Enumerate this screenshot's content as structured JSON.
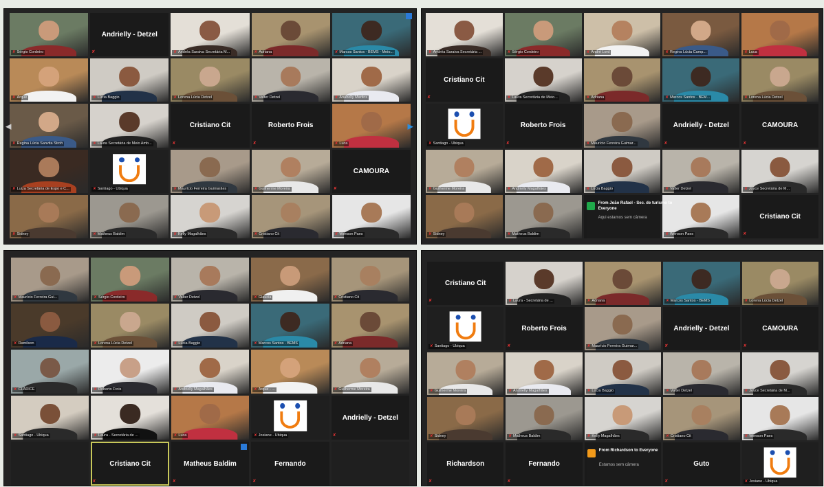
{
  "colors": {
    "tile_bg": "#1f1f1f",
    "active_border": "#c8c85a",
    "mic_muted": "#e03333",
    "logo_orange": "#f07c10",
    "logo_blue": "#1c4fb0",
    "chat_icon_green": "#1fa84a",
    "chat_icon_orange": "#f39a1a"
  },
  "icons": {
    "muted": "mic-muted-icon",
    "nav_left": "chevron-left-icon",
    "nav_right": "chevron-right-icon"
  },
  "panels": [
    {
      "cols": 5,
      "rows": 5,
      "tiles": [
        {
          "n": "Sérgio Cordeiro",
          "v": 1,
          "a": 1,
          "c": [
            "#6b7b63",
            "#c99a7a",
            "#8a2a2a"
          ]
        },
        {
          "b": "Andrielly - Detzel"
        },
        {
          "n": "Andréa Saraiva Secretária M...",
          "v": 1,
          "c": [
            "#e4dfd7",
            "#8a5a44",
            "#3a2c26"
          ]
        },
        {
          "n": "Adriana",
          "v": 1,
          "c": [
            "#a8936f",
            "#6b4a38",
            "#7b2a2a"
          ]
        },
        {
          "n": "Marcos Santos - BEMS - Meio...",
          "v": 1,
          "c": [
            "#3a6a78",
            "#3d2a22",
            "#2a8aa8"
          ]
        },
        {
          "n": "Arque",
          "v": 1,
          "c": [
            "#b98a58",
            "#d4a27a",
            "#f2f2f2"
          ]
        },
        {
          "n": "Lúcia Baggio",
          "v": 1,
          "c": [
            "#cfcbc4",
            "#8b5a40",
            "#223248"
          ]
        },
        {
          "n": "Lorena Lúcia Detzel",
          "v": 1,
          "c": [
            "#9a8a64",
            "#c9a78e",
            "#6b5038"
          ]
        },
        {
          "n": "Valter Detzel",
          "v": 1,
          "c": [
            "#b9b4aa",
            "#a87a5c",
            "#2a2a30"
          ]
        },
        {
          "n": "Anahelly Martins",
          "v": 1,
          "c": [
            "#d9d3c9",
            "#a06a48",
            "#e9eaf0"
          ]
        },
        {
          "n": "Regina Lúcia Sanvita Stroh",
          "v": 1,
          "c": [
            "#6a5a48",
            "#d2a888",
            "#3a5a88"
          ]
        },
        {
          "n": "Laura Secretária de Meio Amb...",
          "v": 1,
          "c": [
            "#d6d2cc",
            "#5a3a2a",
            "#222222"
          ]
        },
        {
          "b": "Cristiano Cit"
        },
        {
          "b": "Roberto Frois"
        },
        {
          "n": "Luca",
          "v": 1,
          "c": [
            "#b57848",
            "#a06a48",
            "#c03040"
          ]
        },
        {
          "n": "Luiza Secretária de Espo e C...",
          "v": 1,
          "c": [
            "#3a2a22",
            "#aa7a5a",
            "#a84020"
          ]
        },
        {
          "n": "Santiago - Ubiqua",
          "logo": 1
        },
        {
          "n": "Maurício Ferreira Guimarães",
          "v": 1,
          "c": [
            "#a89a8a",
            "#8a6a50",
            "#303840"
          ]
        },
        {
          "n": "Guilherme Moreira",
          "v": 1,
          "c": [
            "#b7ab98",
            "#b08060",
            "#e8e8e8"
          ]
        },
        {
          "b": "CAMOURA"
        },
        {
          "n": "Sidney",
          "v": 1,
          "c": [
            "#8a6a48",
            "#a87a58",
            "#4a3a30"
          ]
        },
        {
          "n": "Matheus Baldim",
          "v": 1,
          "c": [
            "#9c9890",
            "#8a6a50",
            "#2a2a2a"
          ]
        },
        {
          "n": "Kelly Magalhães",
          "v": 1,
          "c": [
            "#d6d4d0",
            "#c89a78",
            "#2a2a2a"
          ]
        },
        {
          "n": "Cristiano Cit",
          "v": 1,
          "c": [
            "#a6957a",
            "#a88060",
            "#2a2a30"
          ]
        },
        {
          "n": "Wenson Paes",
          "v": 1,
          "c": [
            "#e6e6e6",
            "#a87a58",
            "#2a2a2a"
          ]
        }
      ]
    },
    {
      "cols": 5,
      "rows": 5,
      "chat": {
        "idx": 22,
        "title": "From João Rafael - Sec. de turismo to Everyone",
        "body": "Aqui estamos sem câmera"
      },
      "tiles": [
        {
          "n": "Andréa Saraiva Secretária ...",
          "v": 1,
          "c": [
            "#e4dfd7",
            "#8a5a44",
            "#3a2c26"
          ]
        },
        {
          "n": "Sérgio Cordeiro",
          "v": 1,
          "a": 1,
          "c": [
            "#6b7b63",
            "#c99a7a",
            "#8a2a2a"
          ]
        },
        {
          "n": "André Lord",
          "v": 1,
          "c": [
            "#cdbfa8",
            "#b58260",
            "#f2f2f2"
          ]
        },
        {
          "n": "Regina Lúcia Camp...",
          "v": 1,
          "c": [
            "#7a5a40",
            "#d2a888",
            "#3a5a88"
          ]
        },
        {
          "n": "Luca",
          "v": 1,
          "c": [
            "#b57848",
            "#a06a48",
            "#c03040"
          ]
        },
        {
          "b": "Cristiano Cit"
        },
        {
          "n": "Laura Secretária de Meio...",
          "v": 1,
          "c": [
            "#d6d2cc",
            "#5a3a2a",
            "#222222"
          ]
        },
        {
          "n": "Adriana",
          "v": 1,
          "c": [
            "#a8936f",
            "#6b4a38",
            "#7b2a2a"
          ]
        },
        {
          "n": "Marcos Santos - BEM...",
          "v": 1,
          "c": [
            "#3a6a78",
            "#3d2a22",
            "#2a8aa8"
          ]
        },
        {
          "n": "Lorena Lúcia Detzel",
          "v": 1,
          "c": [
            "#9a8a64",
            "#c9a78e",
            "#6b5038"
          ]
        },
        {
          "n": "Santiago - Ubiqua",
          "logo": 1
        },
        {
          "b": "Roberto Frois"
        },
        {
          "n": "Maurício Ferreira Guimar...",
          "v": 1,
          "c": [
            "#a89a8a",
            "#8a6a50",
            "#303840"
          ]
        },
        {
          "b": "Andrielly - Detzel"
        },
        {
          "b": "CAMOURA"
        },
        {
          "n": "Guilherme Moreira",
          "v": 1,
          "c": [
            "#b7ab98",
            "#b08060",
            "#e8e8e8"
          ]
        },
        {
          "n": "Andrielly Magalhães",
          "v": 1,
          "c": [
            "#d9d3c9",
            "#a06a48",
            "#e9eaf0"
          ]
        },
        {
          "n": "Lúcia Baggio",
          "v": 1,
          "c": [
            "#cfcbc4",
            "#8b5a40",
            "#223248"
          ]
        },
        {
          "n": "Valter Detzel",
          "v": 1,
          "c": [
            "#b9b4aa",
            "#a87a5c",
            "#2a2a30"
          ]
        },
        {
          "n": "Joyce Secretária de M...",
          "v": 1,
          "c": [
            "#d6d4d0",
            "#8a5a40",
            "#2a2a2a"
          ]
        },
        {
          "n": "Sidney",
          "v": 1,
          "c": [
            "#8a6a48",
            "#a87a58",
            "#4a3a30"
          ]
        },
        {
          "n": "Matheus Baldim",
          "v": 1,
          "c": [
            "#9c9890",
            "#8a6a50",
            "#2a2a2a"
          ]
        },
        {
          "e": 1
        },
        {
          "n": "Wenson Paes",
          "v": 1,
          "c": [
            "#e6e6e6",
            "#a87a58",
            "#2a2a2a"
          ]
        },
        {
          "b": "Cristiano Cit"
        }
      ]
    },
    {
      "cols": 5,
      "rows": 5,
      "tiles": [
        {
          "n": "Maurício Ferreira Gui...",
          "v": 1,
          "c": [
            "#a89a8a",
            "#8a6a50",
            "#303840"
          ]
        },
        {
          "n": "Sérgio Cordeiro",
          "v": 1,
          "c": [
            "#6b7b63",
            "#c99a7a",
            "#8a2a2a"
          ]
        },
        {
          "n": "Valter Detzel",
          "v": 1,
          "c": [
            "#b9b4aa",
            "#a87a5c",
            "#2a2a30"
          ]
        },
        {
          "n": "Glaucia",
          "v": 1,
          "c": [
            "#8a6a4a",
            "#c89a78",
            "#f0f0f0"
          ]
        },
        {
          "n": "Cristiano Cit",
          "v": 1,
          "c": [
            "#a6957a",
            "#a88060",
            "#2a2a30"
          ]
        },
        {
          "n": "Ramilson",
          "v": 1,
          "c": [
            "#4a3a2a",
            "#8a5a40",
            "#1a2a48"
          ]
        },
        {
          "n": "Lorena Lúcia Detzel",
          "v": 1,
          "c": [
            "#9a8a64",
            "#c9a78e",
            "#6b5038"
          ]
        },
        {
          "n": "Lúcia Baggio",
          "v": 1,
          "c": [
            "#cfcbc4",
            "#8b5a40",
            "#223248"
          ]
        },
        {
          "n": "Marcos Santos - BEMS",
          "v": 1,
          "c": [
            "#3a6a78",
            "#3d2a22",
            "#2a8aa8"
          ]
        },
        {
          "n": "Adriana",
          "v": 1,
          "c": [
            "#a8936f",
            "#6b4a38",
            "#7b2a2a"
          ]
        },
        {
          "n": "CLARICE",
          "v": 1,
          "c": [
            "#9aa8a8",
            "#7a5a48",
            "#2a2a2a"
          ]
        },
        {
          "n": "Roberto Frois",
          "v": 1,
          "c": [
            "#ececec",
            "#c8a088",
            "#2a2a30"
          ]
        },
        {
          "n": "Andrielly Magalhães",
          "v": 1,
          "c": [
            "#d9d3c9",
            "#a06a48",
            "#e9eaf0"
          ]
        },
        {
          "n": "Arque - ...",
          "v": 1,
          "c": [
            "#b98a58",
            "#d4a27a",
            "#f2f2f2"
          ]
        },
        {
          "n": "Guilherme Moreira",
          "v": 1,
          "c": [
            "#b7ab98",
            "#b08060",
            "#e8e8e8"
          ]
        },
        {
          "n": "Santiago - Ubiqua",
          "v": 1,
          "c": [
            "#d4ccc0",
            "#7a5038",
            "#2a2a2a"
          ]
        },
        {
          "n": "Laura - Secretária de ...",
          "v": 1,
          "c": [
            "#e4e0da",
            "#3a2a22",
            "#111111"
          ]
        },
        {
          "n": "Luca",
          "v": 1,
          "c": [
            "#b57848",
            "#a06a48",
            "#c03040"
          ]
        },
        {
          "n": "Josiane - Ubiqua",
          "logo": 1
        },
        {
          "b": "Andrielly - Detzel"
        },
        {
          "e": 1
        },
        {
          "b": "Cristiano Cit",
          "a": 1
        },
        {
          "b": "Matheus Baldim",
          "sq": 1
        },
        {
          "b": "Fernando"
        },
        {
          "e": 1
        }
      ]
    },
    {
      "cols": 5,
      "rows": 5,
      "chat": {
        "idx": 22,
        "title": "From Richardson to Everyone",
        "body": "Estamos sem câmera"
      },
      "tiles": [
        {
          "b": "Cristiano Cit"
        },
        {
          "n": "Laura - Secretária de ...",
          "v": 1,
          "c": [
            "#d6d2cc",
            "#5a3a2a",
            "#222222"
          ]
        },
        {
          "n": "Adriana",
          "v": 1,
          "c": [
            "#a8936f",
            "#6b4a38",
            "#7b2a2a"
          ]
        },
        {
          "n": "Marcos Santos - BEMS",
          "v": 1,
          "c": [
            "#3a6a78",
            "#3d2a22",
            "#2a8aa8"
          ]
        },
        {
          "n": "Lorena Lúcia Detzel",
          "v": 1,
          "c": [
            "#9a8a64",
            "#c9a78e",
            "#6b5038"
          ]
        },
        {
          "n": "Santiago - Ubiqua",
          "logo": 1
        },
        {
          "b": "Roberto Frois"
        },
        {
          "n": "Maurício Ferreira Guimar...",
          "v": 1,
          "c": [
            "#a89a8a",
            "#8a6a50",
            "#303840"
          ]
        },
        {
          "b": "Andrielly - Detzel"
        },
        {
          "b": "CAMOURA"
        },
        {
          "n": "Guilherme Moreira",
          "v": 1,
          "c": [
            "#b7ab98",
            "#b08060",
            "#e8e8e8"
          ]
        },
        {
          "n": "Andrielly Magalhães",
          "v": 1,
          "c": [
            "#d9d3c9",
            "#a06a48",
            "#e9eaf0"
          ]
        },
        {
          "n": "Lúcia Baggio",
          "v": 1,
          "c": [
            "#cfcbc4",
            "#8b5a40",
            "#223248"
          ]
        },
        {
          "n": "Valter Detzel",
          "v": 1,
          "a": 1,
          "c": [
            "#b9b4aa",
            "#a87a5c",
            "#2a2a30"
          ]
        },
        {
          "n": "Joyce Secretária de M...",
          "v": 1,
          "c": [
            "#d6d4d0",
            "#8a5a40",
            "#2a2a2a"
          ]
        },
        {
          "n": "Sidney",
          "v": 1,
          "c": [
            "#8a6a48",
            "#a87a58",
            "#4a3a30"
          ]
        },
        {
          "n": "Matheus Baldim",
          "v": 1,
          "c": [
            "#9c9890",
            "#8a6a50",
            "#2a2a2a"
          ]
        },
        {
          "n": "Kelly Magalhães",
          "v": 1,
          "c": [
            "#d6d4d0",
            "#c89a78",
            "#2a2a2a"
          ]
        },
        {
          "n": "Cristiano Cit",
          "v": 1,
          "c": [
            "#a6957a",
            "#a88060",
            "#2a2a30"
          ]
        },
        {
          "n": "Wenson Paes",
          "v": 1,
          "c": [
            "#e6e6e6",
            "#a87a58",
            "#2a2a2a"
          ]
        },
        {
          "b": "Richardson"
        },
        {
          "b": "Fernando"
        },
        {
          "e": 1
        },
        {
          "b": "Guto"
        },
        {
          "n": "Josiane - Ubiqua",
          "logo": 1
        }
      ]
    }
  ]
}
